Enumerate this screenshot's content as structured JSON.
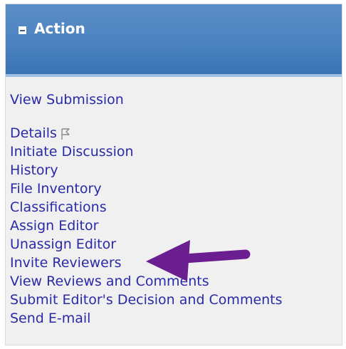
{
  "panel": {
    "title": "Action",
    "header_color": "#4f85c2",
    "collapse_icon": "minus-box-icon"
  },
  "links": {
    "view_submission": "View Submission",
    "details": "Details",
    "details_icon": "flag-icon",
    "items": [
      "Initiate Discussion",
      "History",
      "File Inventory",
      "Classifications",
      "Assign Editor",
      "Unassign Editor",
      "Invite Reviewers",
      "View Reviews and Comments",
      "Submit Editor's Decision and Comments",
      "Send E-mail"
    ],
    "link_color": "#2a2aa8"
  },
  "annotation": {
    "icon": "arrow-left-icon",
    "color": "#6a1e8f"
  }
}
